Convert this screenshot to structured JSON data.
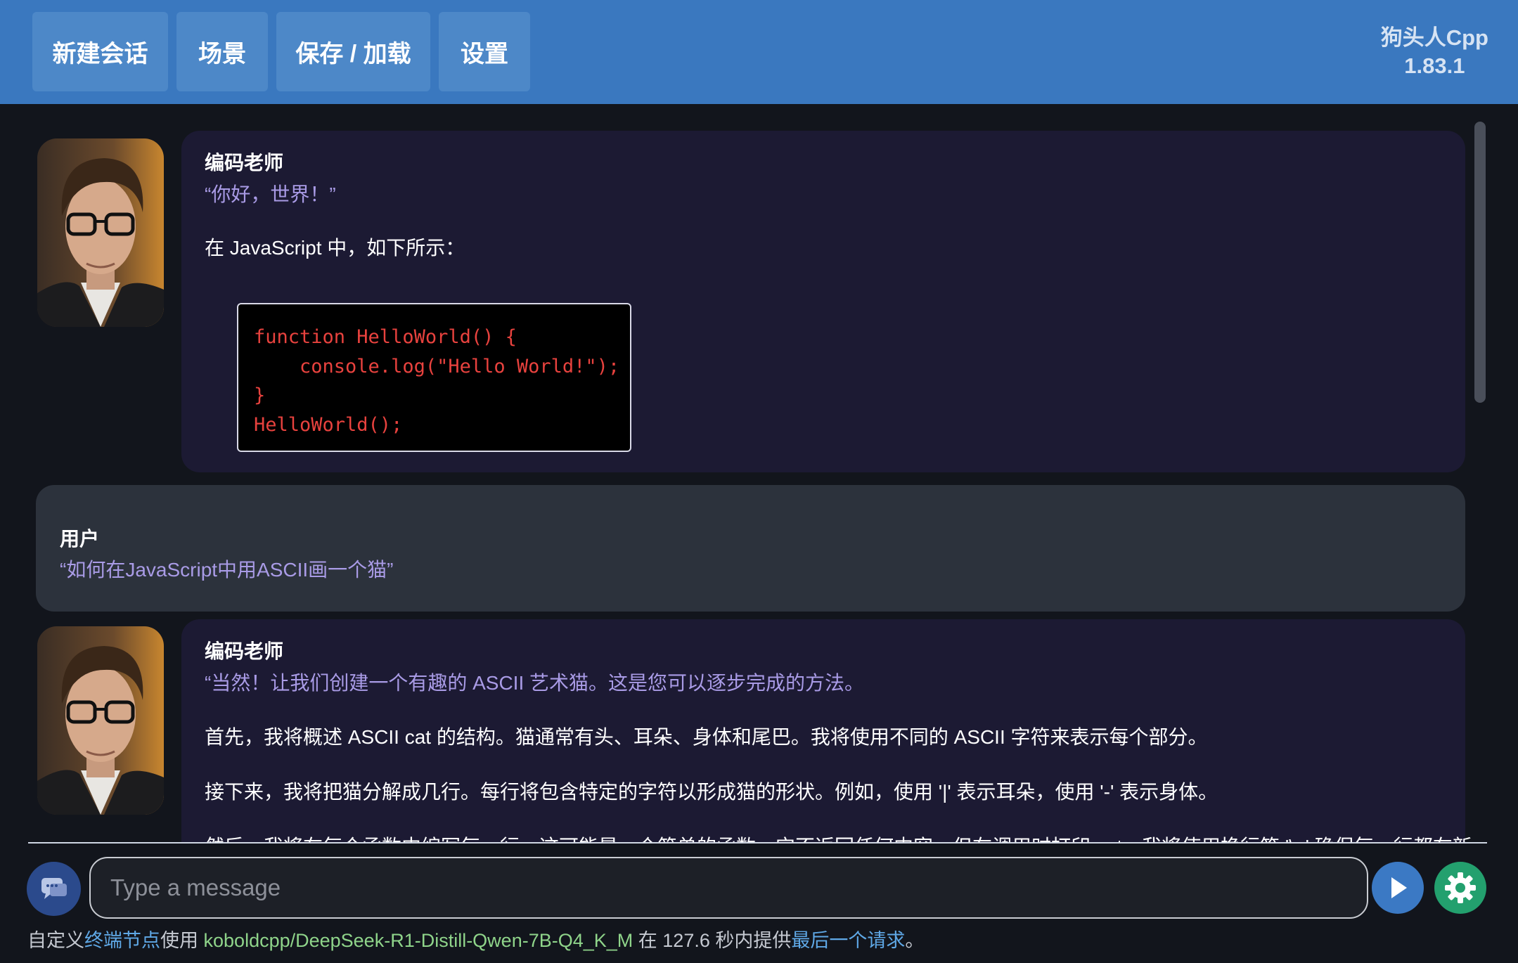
{
  "topbar": {
    "buttons": [
      "新建会话",
      "场景",
      "保存 / 加载",
      "设置"
    ],
    "brand_name": "狗头人Cpp",
    "version": "1.83.1",
    "color": "#3a78bf"
  },
  "messages": [
    {
      "speaker": "编码老师",
      "quote": "“你好，世界！”",
      "text": "在 JavaScript 中，如下所示：",
      "code": [
        "function HelloWorld() {",
        "    console.log(\"Hello World!\");",
        "}",
        "HelloWorld();"
      ]
    },
    {
      "speaker": "用户",
      "quote": "“如何在JavaScript中用ASCII画一个猫”"
    },
    {
      "speaker": "编码老师",
      "quote": "“当然！让我们创建一个有趣的 ASCII 艺术猫。这是您可以逐步完成的方法。",
      "paragraphs": [
        "首先，我将概述 ASCII cat 的结构。猫通常有头、耳朵、身体和尾巴。我将使用不同的 ASCII 字符来表示每个部分。",
        "接下来，我将把猫分解成几行。每行将包含特定的字符以形成猫的形状。例如，使用 '|' 表示耳朵，使用 '-' 表示身体。",
        "然后，我将在每个函数中编写每一行，这可能是一个简单的函数，它不返回任何内容，但在调用时打印 cat。我将使用换行符 '\\n' 确保每一行都在新"
      ]
    }
  ],
  "input": {
    "placeholder": "Type a message"
  },
  "footer": {
    "prefix": "自定义",
    "endpoint_link": "终端节点",
    "using": "使用 ",
    "model": "koboldcpp/DeepSeek-R1-Distill-Qwen-7B-Q4_K_M",
    "mid": " 在 127.6 秒内提供",
    "last_request_link": "最后一个请求",
    "suffix": "。"
  },
  "icons": [
    "chat-icon",
    "send-icon",
    "gear-icon"
  ]
}
